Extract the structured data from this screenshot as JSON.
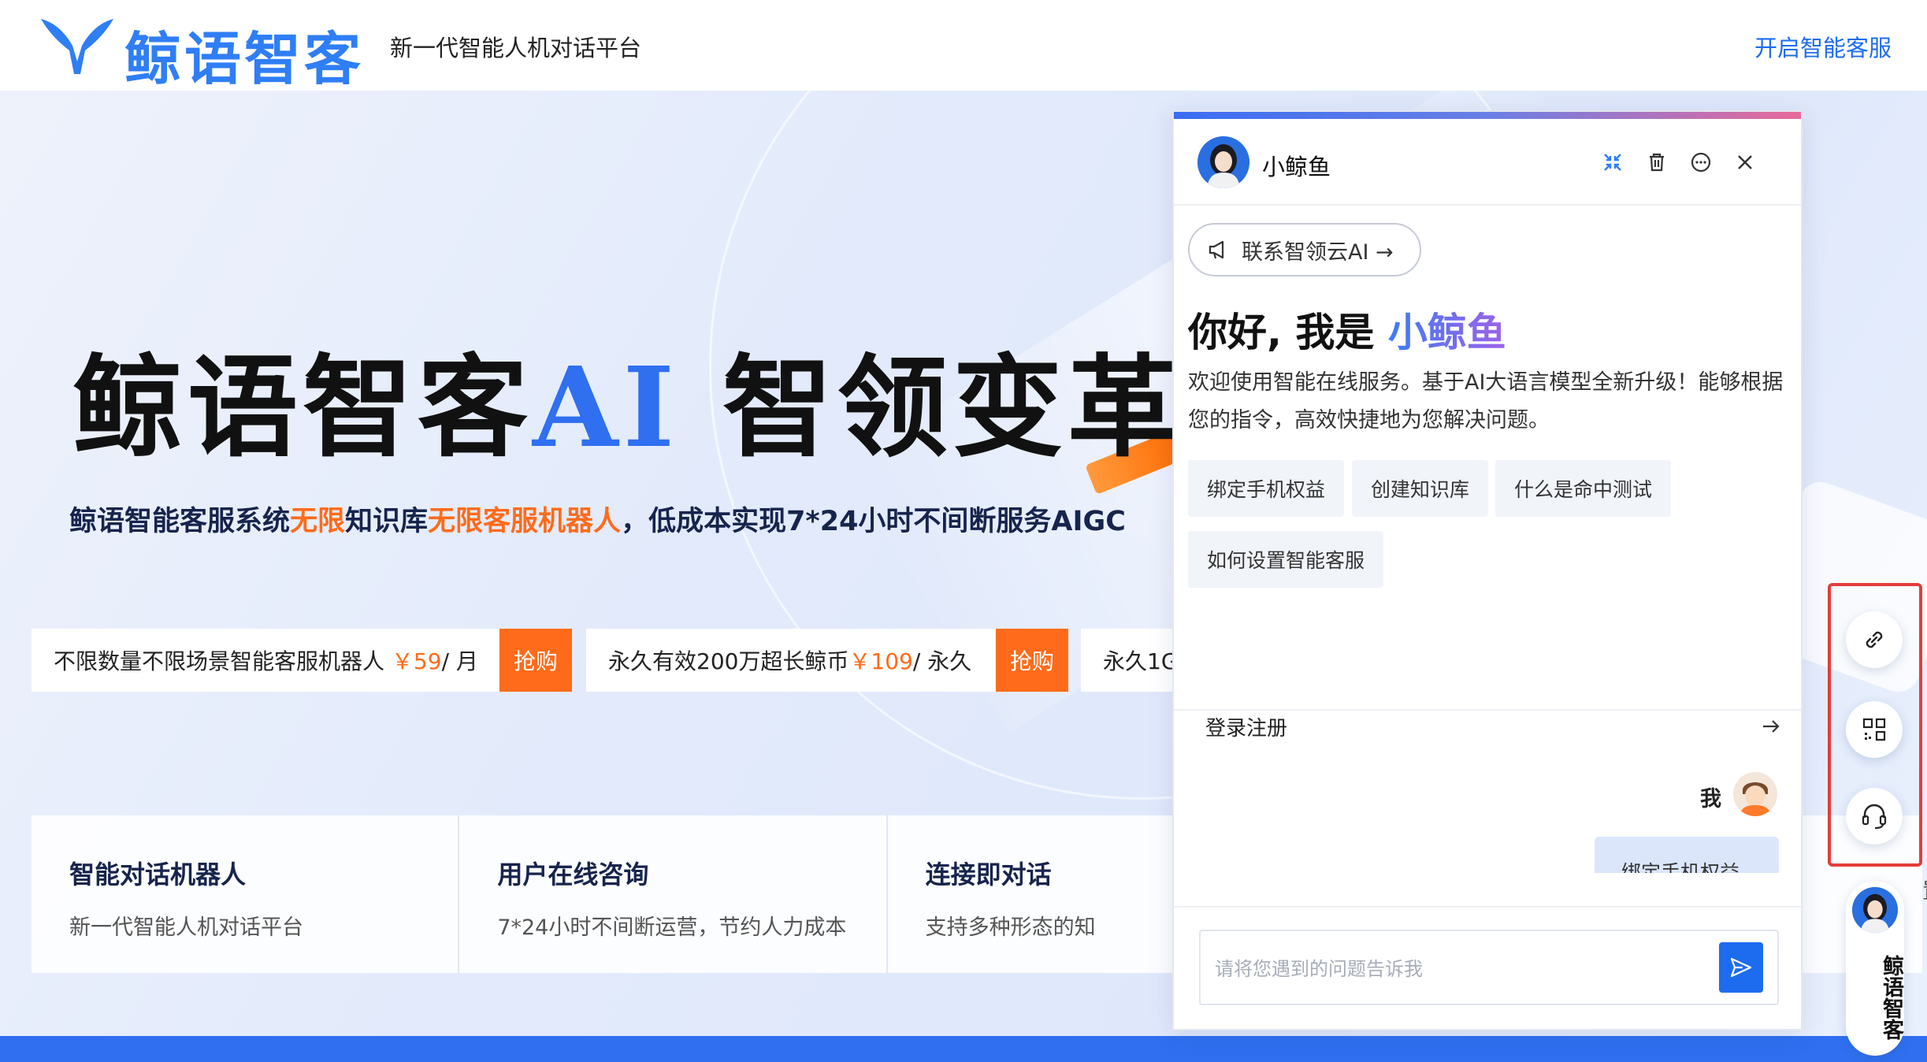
{
  "nav": {
    "brand": "鲸语智客",
    "slogan": "新一代智能人机对话平台",
    "cta": "开启智能客服"
  },
  "hero": {
    "title_main": "鲸语智客",
    "title_ai": "AI",
    "title_tail": " 智领变革",
    "subtitle_1": "鲸语智能客服系统",
    "subtitle_hl1": "无限",
    "subtitle_2": "知识库",
    "subtitle_hl2": "无限客服机器人",
    "subtitle_3": "，低成本实现7*24小时不间断服务AIGC"
  },
  "promos": [
    {
      "text": "不限数量不限场景智能客服机器人",
      "price": "￥59",
      "unit": "/ 月",
      "buy": "抢购"
    },
    {
      "text": "永久有效200万超长鲸币",
      "price": "￥109",
      "unit": "/ 永久",
      "buy": "抢购"
    },
    {
      "text": "永久1G",
      "price": "",
      "unit": "",
      "buy": ""
    }
  ],
  "features": [
    {
      "title": "智能对话机器人",
      "desc": "新一代智能人机对话平台"
    },
    {
      "title": "用户在线咨询",
      "desc": "7*24小时不间断运营，节约人力成本"
    },
    {
      "title": "连接即对话",
      "desc": "支持多种形态的知"
    },
    {
      "title": "",
      "desc": "置"
    }
  ],
  "chat": {
    "bot_name": "小鲸鱼",
    "contact_label": "联系智领云AI →",
    "greet_prefix": "你好, 我是 ",
    "greet_name": "小鲸鱼",
    "welcome": "欢迎使用智能在线服务。基于AI大语言模型全新升级！能够根据您的指令，高效快捷地为您解决问题。",
    "chips": [
      "绑定手机权益",
      "创建知识库",
      "什么是命中测试",
      "如何设置智能客服"
    ],
    "login_label": "登录注册",
    "me_label": "我",
    "me_message": "绑定手机权益",
    "input_placeholder": "请将您遇到的问题告诉我"
  },
  "side": {
    "brand_label": "鲸语智客"
  },
  "icons": {
    "header": [
      "compress-icon",
      "trash-icon",
      "chat-bubble-icon",
      "close-icon"
    ],
    "side": [
      "link-icon",
      "qrcode-icon",
      "headset-icon"
    ]
  },
  "colors": {
    "brand_blue": "#2f7ef5",
    "accent_orange": "#ff6b1a",
    "highlight_red": "#e63b3b"
  }
}
